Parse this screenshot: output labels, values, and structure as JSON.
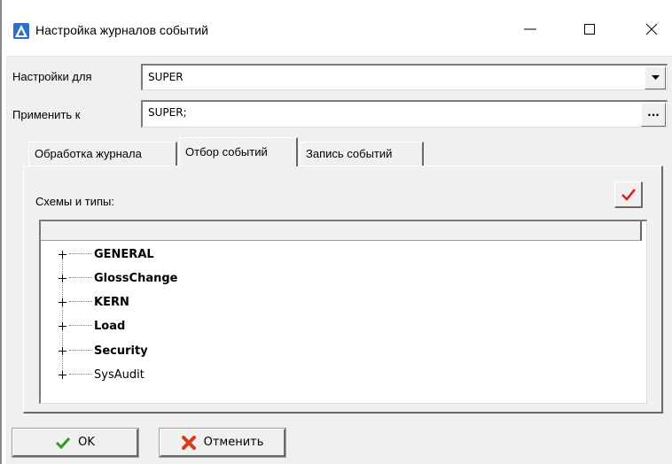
{
  "window": {
    "title": "Настройка журналов событий",
    "controls": {
      "minimize": "—",
      "maximize": "☐",
      "close": "✕"
    }
  },
  "form": {
    "settings_for_label": "Настройки для",
    "settings_for_value": "SUPER",
    "apply_to_label": "Применить к",
    "apply_to_value": "SUPER;",
    "ellipsis_label": "···"
  },
  "tabs": [
    {
      "label": "Обработка журнала",
      "active": false
    },
    {
      "label": "Отбор событий",
      "active": true
    },
    {
      "label": "Запись событий",
      "active": false
    }
  ],
  "panel": {
    "schemes_label": "Схемы и типы:",
    "tree": [
      {
        "label": "GENERAL",
        "bold": true
      },
      {
        "label": "GlossChange",
        "bold": true
      },
      {
        "label": "KERN",
        "bold": true
      },
      {
        "label": "Load",
        "bold": true
      },
      {
        "label": "Security",
        "bold": true
      },
      {
        "label": "SysAudit",
        "bold": false
      }
    ]
  },
  "buttons": {
    "ok_label": "OK",
    "cancel_label": "Отменить"
  },
  "colors": {
    "app_icon": "#2f6fc2",
    "check_red": "#e01818",
    "ok_green": "#2e9a1e",
    "cancel_red": "#d83a1a"
  },
  "icons": [
    "app-icon",
    "minimize-icon",
    "maximize-icon",
    "close-icon",
    "dropdown-arrow-icon",
    "checkmark-icon",
    "ok-check-icon",
    "cancel-x-icon"
  ]
}
